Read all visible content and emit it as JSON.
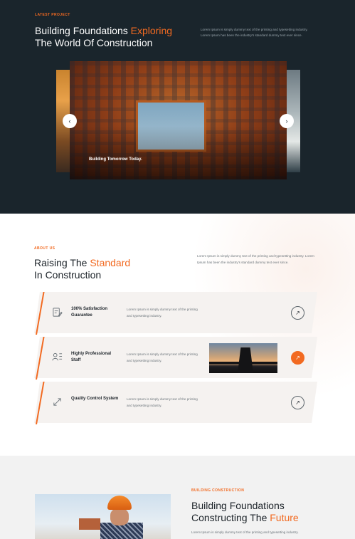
{
  "latest_project": {
    "eyebrow": "LATEST PROJECT",
    "title_main": "Building Foundations ",
    "title_highlight": "Exploring",
    "title_line2": "The World Of Construction",
    "intro": "Lorem Ipsum is simply dummy text of the printing and typesetting industry. Lorem Ipsum has been the industry's standard dummy text ever since.",
    "slide_caption": "Building Tomorrow Today.",
    "prev_icon": "‹",
    "next_icon": "›"
  },
  "about": {
    "eyebrow": "ABOUT US",
    "title_main": "Raising The ",
    "title_highlight": "Standard",
    "title_line2": "In Construction",
    "intro": "Lorem Ipsum is simply dummy text of the printing and typesetting industry. Lorem Ipsum has been the industry's standard dummy text ever since.",
    "features": [
      {
        "title": "100% Satisfaction Guarantee",
        "description": "Lorem Ipsum is simply dummy text of the printing and typesetting industry.",
        "icon": "document-pen-icon",
        "arrow": "↗",
        "active": false
      },
      {
        "title": "Highly Professional Staff",
        "description": "Lorem Ipsum is simply dummy text of the printing and typesetting industry.",
        "icon": "team-icon",
        "arrow": "↗",
        "active": true
      },
      {
        "title": "Quality Control System",
        "description": "Lorem Ipsum is simply dummy text of the printing and typesetting industry.",
        "icon": "resize-arrows-icon",
        "arrow": "↗",
        "active": false
      }
    ]
  },
  "building": {
    "eyebrow": "BUILDING CONSTRUCTION",
    "title_line1": "Building Foundations",
    "title_main": "Constructing The ",
    "title_highlight": "Future",
    "intro": "Lorem Ipsum is simply dummy text of the printing and typesetting industry."
  },
  "colors": {
    "accent": "#f26a21",
    "dark_bg": "#1a252c",
    "light_bg": "#f2f2f2"
  }
}
